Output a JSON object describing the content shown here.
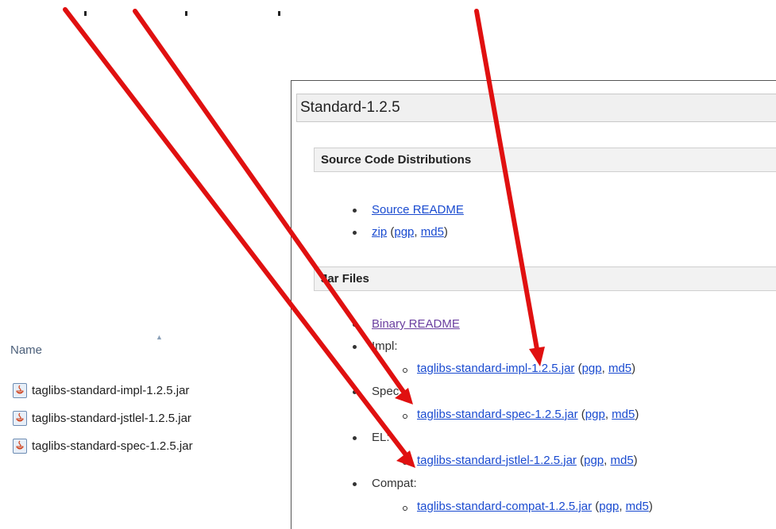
{
  "explorer": {
    "column_header": "Name",
    "files": [
      {
        "name": "taglibs-standard-impl-1.2.5.jar",
        "icon": "java-jar-icon"
      },
      {
        "name": "taglibs-standard-jstlel-1.2.5.jar",
        "icon": "java-jar-icon"
      },
      {
        "name": "taglibs-standard-spec-1.2.5.jar",
        "icon": "java-jar-icon"
      }
    ]
  },
  "page": {
    "title": "Standard-1.2.5",
    "source_section": {
      "heading": "Source Code Distributions",
      "source_readme": "Source README",
      "zip": "zip",
      "pgp": "pgp",
      "md5": "md5"
    },
    "jar_section": {
      "heading": "Jar Files",
      "binary_readme": "Binary README",
      "groups": [
        {
          "label": "Impl:",
          "jar": "taglibs-standard-impl-1.2.5.jar",
          "pgp": "pgp",
          "md5": "md5"
        },
        {
          "label": "Spec:",
          "jar": "taglibs-standard-spec-1.2.5.jar",
          "pgp": "pgp",
          "md5": "md5"
        },
        {
          "label": "EL:",
          "jar": "taglibs-standard-jstlel-1.2.5.jar",
          "pgp": "pgp",
          "md5": "md5"
        },
        {
          "label": "Compat:",
          "jar": "taglibs-standard-compat-1.2.5.jar",
          "pgp": "pgp",
          "md5": "md5"
        }
      ]
    }
  },
  "colors": {
    "link": "#1a4bd0",
    "visited_link": "#6b3fa0",
    "arrow": "#e01010"
  }
}
